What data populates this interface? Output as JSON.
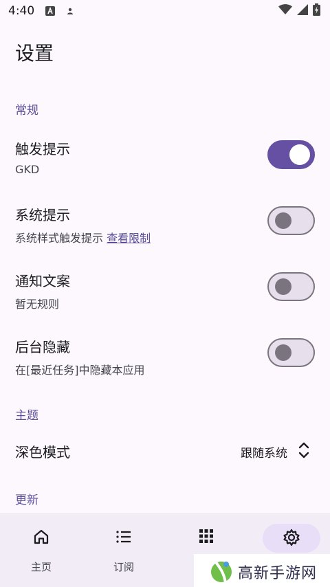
{
  "status_bar": {
    "time": "4:40",
    "icons": [
      "font-a-icon",
      "person-icon",
      "wifi-icon",
      "signal-icon",
      "battery-charging-icon"
    ]
  },
  "page": {
    "title": "设置"
  },
  "sections": {
    "general": "常规",
    "theme": "主题",
    "update": "更新"
  },
  "settings": [
    {
      "title": "触发提示",
      "subtitle": "GKD",
      "enabled": true
    },
    {
      "title": "系统提示",
      "subtitle": "系统样式触发提示",
      "link": "查看限制",
      "enabled": false
    },
    {
      "title": "通知文案",
      "subtitle": "暂无规则",
      "enabled": false
    },
    {
      "title": "后台隐藏",
      "subtitle": "在[最近任务]中隐藏本应用",
      "enabled": false
    }
  ],
  "dark_mode": {
    "title": "深色模式",
    "value": "跟随系统"
  },
  "bottom_nav": {
    "items": [
      {
        "label": "主页",
        "icon": "home-icon"
      },
      {
        "label": "订阅",
        "icon": "list-icon"
      },
      {
        "label": "",
        "icon": "apps-grid-icon"
      },
      {
        "label": "",
        "icon": "gear-icon",
        "active": true
      }
    ]
  },
  "watermark": {
    "text": "高新手游网"
  },
  "colors": {
    "accent": "#6650a4",
    "section_header": "#5b4e9c",
    "background": "#fdf8fd",
    "nav_background": "#f2ecf6",
    "active_pill": "#e8def8"
  }
}
